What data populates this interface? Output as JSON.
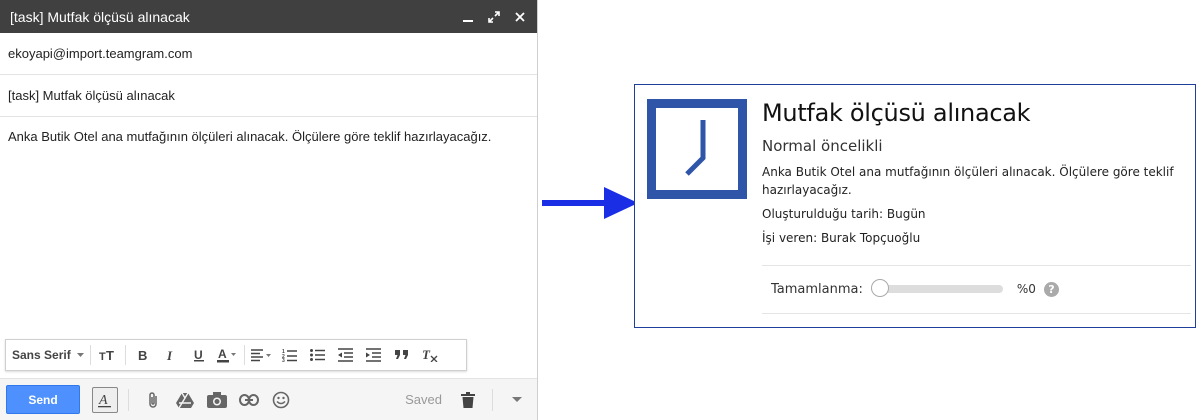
{
  "compose": {
    "title": "[task] Mutfak ölçüsü alınacak",
    "to": "ekoyapi@import.teamgram.com",
    "subject": "[task] Mutfak ölçüsü alınacak",
    "body": "Anka Butik Otel ana mutfağının ölçüleri alınacak. Ölçülere göre teklif hazırlayacağız.",
    "header_icons": [
      "minimize-icon",
      "expand-icon",
      "close-icon"
    ],
    "toolbar": {
      "font": "Sans Serif",
      "buttons": [
        "text-size-icon",
        "bold-icon",
        "italic-icon",
        "underline-icon",
        "text-color-icon",
        "align-icon",
        "numbered-list-icon",
        "bulleted-list-icon",
        "indent-less-icon",
        "indent-more-icon",
        "quote-icon",
        "remove-formatting-icon"
      ]
    },
    "send_label": "Send",
    "saved_label": "Saved"
  },
  "task_card": {
    "title": "Mutfak ölçüsü alınacak",
    "priority": "Normal öncelikli",
    "description": "Anka Butik Otel ana mutfağının ölçüleri alınacak. Ölçülere göre teklif hazırlayacağız.",
    "created_label": "Oluşturulduğu tarih: Bugün",
    "assigner_label": "İşi veren: Burak Topçuoğlu",
    "progress_label": "Tamamlanma:",
    "progress_value_text": "%0",
    "progress_fraction": 0,
    "help_symbol": "?",
    "accent_color": "#2e55a8"
  },
  "arrow_color": "#1a2ee6"
}
